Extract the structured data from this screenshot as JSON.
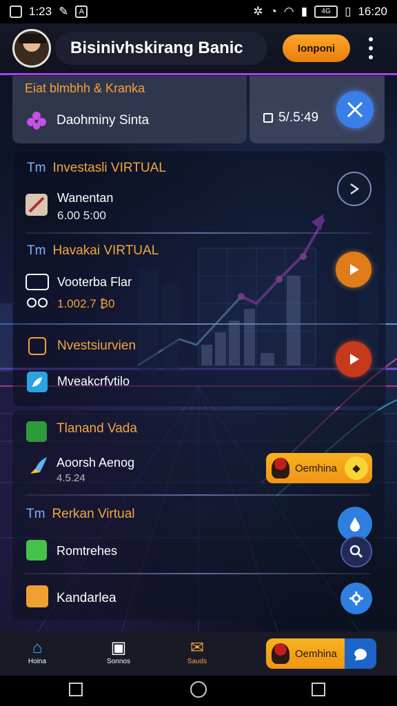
{
  "status_bar": {
    "left_time": "1:23",
    "left_icon_a": "A",
    "right_badge": "4G",
    "right_time": "16:20"
  },
  "header": {
    "title": "Bisinivhskirang Banic",
    "action_button": "Ionponi"
  },
  "top_card": {
    "line1": "Eiat blmbhh & Kranka",
    "item_label": "Daohminy Sinta",
    "timer": "5/.5:49"
  },
  "sections": [
    {
      "prefix": "Tm",
      "title": "Investasli VIRTUAL",
      "item_label": "Wanentan",
      "item_value": "6.00 5:00"
    },
    {
      "prefix": "Tm",
      "title": "Havakai VIRTUAL",
      "item_label": "Vooterba Flar",
      "item_value": "1.002.7 ₿0"
    },
    {
      "prefix": "",
      "title": "Nvestsiurvien",
      "item_label": "Mveakcrfvtilo",
      "item_value": ""
    },
    {
      "prefix": "",
      "title": "Tlanand Vada",
      "item_label": "Aoorsh Aenog",
      "item_value": "4.5.24"
    },
    {
      "prefix": "Tm",
      "title": "Rerkan Virtual",
      "item_label": "Romtrehes",
      "item_value": ""
    },
    {
      "prefix": "",
      "title": "",
      "item_label": "Kandarlea",
      "item_value": ""
    }
  ],
  "promo_pill": {
    "label": "Oemhina"
  },
  "bottom_nav": {
    "items": [
      {
        "label": "Hoina",
        "icon": "home-icon"
      },
      {
        "label": "Sonnos",
        "icon": "camera-icon"
      },
      {
        "label": "Sauds",
        "icon": "chart-icon"
      }
    ],
    "promo_label": "Oemhina"
  },
  "colors": {
    "accent_orange": "#f6a23a",
    "accent_purple": "#b13cf0",
    "blue_button": "#2f7fe0"
  }
}
